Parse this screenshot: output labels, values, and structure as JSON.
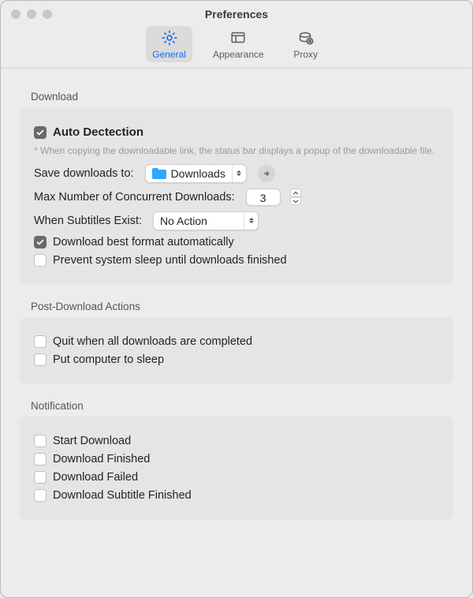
{
  "window": {
    "title": "Preferences"
  },
  "tabs": {
    "general": "General",
    "appearance": "Appearance",
    "proxy": "Proxy",
    "active": "general"
  },
  "sections": {
    "download": {
      "title": "Download",
      "auto_detection": {
        "label": "Auto Dectection",
        "checked": true
      },
      "auto_detection_hint": "* When copying the downloadable link, the status bar displays a popup of the downloadable file.",
      "save_to": {
        "label": "Save downloads to:",
        "value": "Downloads"
      },
      "max_concurrent": {
        "label": "Max Number of Concurrent Downloads:",
        "value": "3"
      },
      "subtitles": {
        "label": "When Subtitles Exist:",
        "value": "No Action"
      },
      "best_format": {
        "label": "Download best format automatically",
        "checked": true
      },
      "prevent_sleep": {
        "label": "Prevent system sleep until downloads finished",
        "checked": false
      }
    },
    "post": {
      "title": "Post-Download Actions",
      "quit": {
        "label": "Quit when all downloads are completed",
        "checked": false
      },
      "sleep": {
        "label": "Put computer to sleep",
        "checked": false
      }
    },
    "notif": {
      "title": "Notification",
      "start": {
        "label": "Start Download",
        "checked": false
      },
      "finished": {
        "label": "Download Finished",
        "checked": false
      },
      "failed": {
        "label": "Download Failed",
        "checked": false
      },
      "sub_finished": {
        "label": "Download Subtitle Finished",
        "checked": false
      }
    }
  }
}
